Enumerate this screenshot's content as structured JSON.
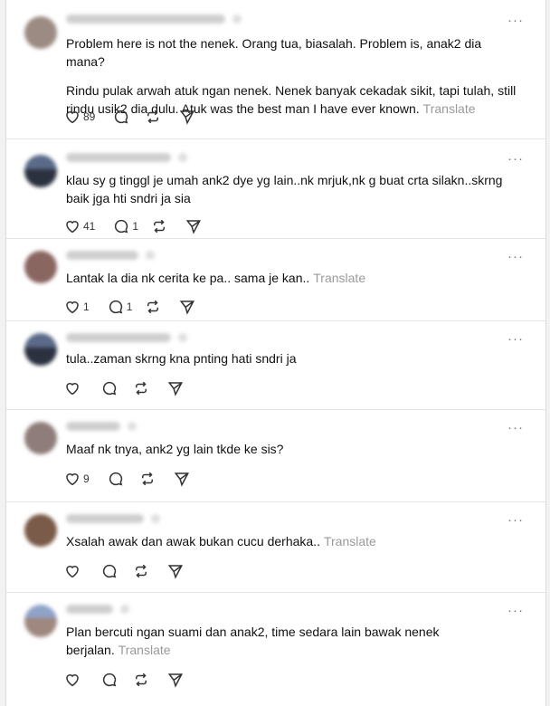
{
  "more_glyph": "···",
  "translate_label": "Translate",
  "posts": [
    {
      "paragraphs": [
        "Problem here is not the nenek. Orang tua, biasalah. Problem is, anak2 dia mana?",
        "Rindu pulak arwah atuk ngan nenek. Nenek banyak cekadak sikit, tapi tulah, still rindu usik2 dia dulu. Atuk was the best man I have ever known."
      ],
      "likes": "89",
      "replies": ""
    },
    {
      "paragraphs": [
        "klau sy g tinggl je umah ank2 dye yg lain..nk mrjuk,nk g buat crta silakn..skrng baik jga hti sndri ja sia"
      ],
      "likes": "41",
      "replies": "1"
    },
    {
      "paragraphs": [
        "Lantak la dia nk cerita ke pa.. sama je kan.."
      ],
      "likes": "1",
      "replies": "1"
    },
    {
      "paragraphs": [
        "tula..zaman skrng kna pnting hati sndri ja"
      ],
      "likes": "",
      "replies": ""
    },
    {
      "paragraphs": [
        "Maaf nk tnya, ank2 yg lain tkde ke sis?"
      ],
      "likes": "9",
      "replies": ""
    },
    {
      "paragraphs": [
        "Xsalah awak dan awak bukan cucu derhaka.."
      ],
      "likes": "",
      "replies": ""
    },
    {
      "paragraphs": [
        "Plan bercuti ngan suami dan anak2, time sedara lain bawak nenek berjalan."
      ],
      "likes": "",
      "replies": ""
    }
  ]
}
